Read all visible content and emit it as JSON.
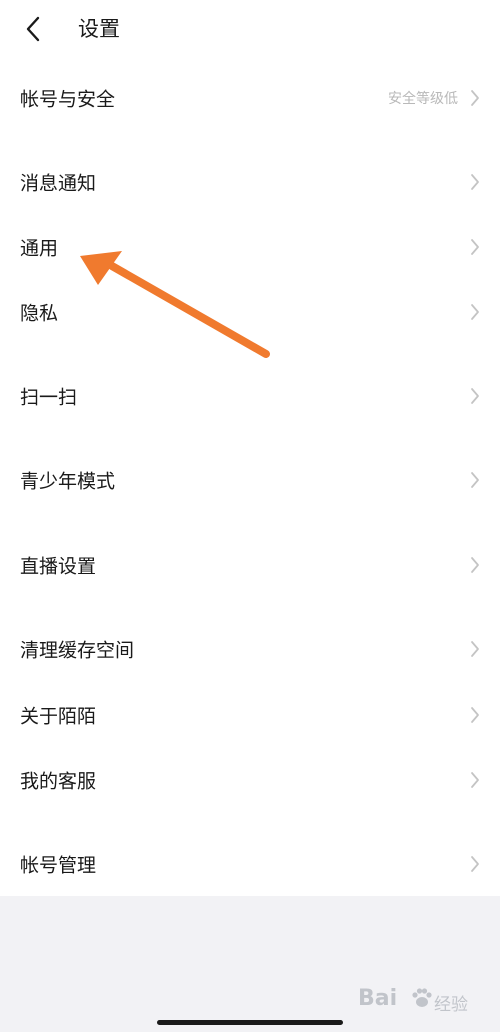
{
  "header": {
    "title": "设置",
    "back_icon": "chevron-left-icon"
  },
  "settings": {
    "items": [
      {
        "key": "account_security",
        "label": "帐号与安全",
        "value": "安全等级低"
      },
      {
        "key": "notifications",
        "label": "消息通知",
        "value": ""
      },
      {
        "key": "general",
        "label": "通用",
        "value": ""
      },
      {
        "key": "privacy",
        "label": "隐私",
        "value": ""
      },
      {
        "key": "scan",
        "label": "扫一扫",
        "value": ""
      },
      {
        "key": "teen_mode",
        "label": "青少年模式",
        "value": ""
      },
      {
        "key": "live_settings",
        "label": "直播设置",
        "value": ""
      },
      {
        "key": "clear_cache",
        "label": "清理缓存空间",
        "value": ""
      },
      {
        "key": "about",
        "label": "关于陌陌",
        "value": ""
      },
      {
        "key": "customer_service",
        "label": "我的客服",
        "value": ""
      },
      {
        "key": "account_management",
        "label": "帐号管理",
        "value": ""
      }
    ],
    "row_icon": "chevron-right-icon"
  },
  "annotation": {
    "arrow_color": "#f07a2e",
    "arrow_target": "通用"
  },
  "watermark": {
    "brand": "Bai",
    "suffix": "经验"
  },
  "colors": {
    "background": "#ffffff",
    "footer_bg": "#f2f2f5",
    "text": "#1a1a1a",
    "muted": "#b9b9b9",
    "chevron": "#c4c4c4"
  }
}
